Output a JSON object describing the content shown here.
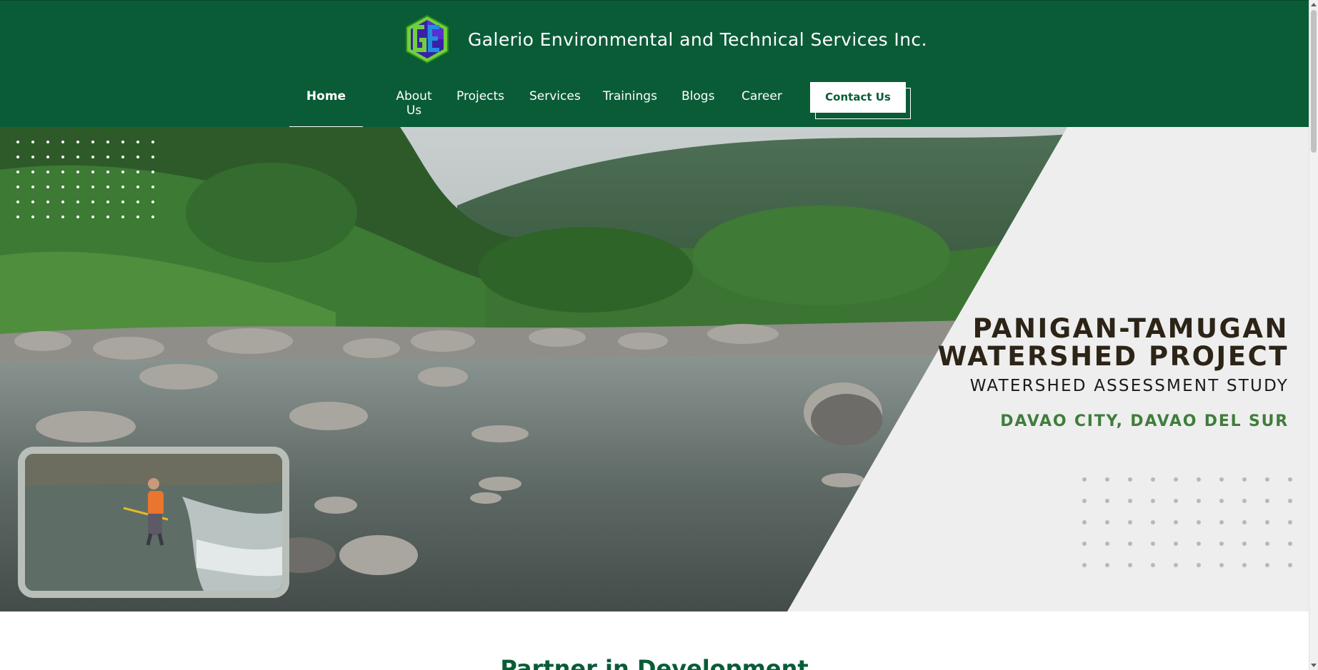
{
  "header": {
    "site_title": "Galerio Environmental and Technical Services Inc.",
    "logo_icon": "ge-hexagon-logo",
    "bg_color": "#0a5c37"
  },
  "nav": {
    "items": [
      {
        "label": "Home",
        "active": true
      },
      {
        "label": "About Us",
        "active": false
      },
      {
        "label": "Projects",
        "active": false
      },
      {
        "label": "Services",
        "active": false
      },
      {
        "label": "Trainings",
        "active": false
      },
      {
        "label": "Blogs",
        "active": false
      },
      {
        "label": "Career",
        "active": false
      }
    ],
    "contact_label": "Contact Us"
  },
  "hero": {
    "title_line1": "PANIGAN-TAMUGAN",
    "title_line2": "WATERSHED PROJECT",
    "subtitle": "WATERSHED ASSESSMENT STUDY",
    "location": "DAVAO CITY, DAVAO DEL SUR",
    "title_color": "#2d2418",
    "location_color": "#3f7d3c",
    "panel_color": "#eeeeee"
  },
  "partners": {
    "title": "Partner in Development"
  }
}
